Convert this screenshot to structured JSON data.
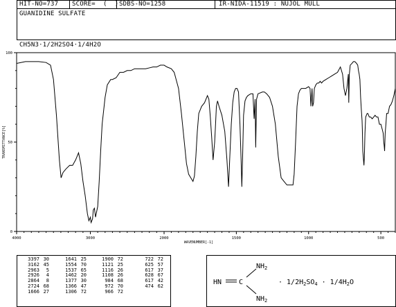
{
  "header": {
    "hit_no": "HIT-NO=737",
    "score": "SCORE=  (  )",
    "sdbs_no": "SDBS-NO=1258",
    "ir_id": "IR-NIDA-11519 : NUJOL MULL",
    "compound_name": "GUANIDINE SULFATE",
    "formula": "CH5N3·1/2H2SO4·1/4H2O"
  },
  "chart_data": {
    "type": "line",
    "xlabel": "WAVENUMBER[-1]",
    "ylabel": "TRANSMITTANCE[%]",
    "xlim": [
      4000,
      400
    ],
    "ylim": [
      0,
      100
    ],
    "x_tick_labels": [
      "4000",
      "3000",
      "2000",
      "1500",
      "1000",
      "500"
    ],
    "y_tick_labels": [
      "0",
      "50",
      "100"
    ],
    "series": [
      {
        "color": "#000000",
        "points": [
          [
            4000,
            94
          ],
          [
            3880,
            95
          ],
          [
            3800,
            95
          ],
          [
            3700,
            95
          ],
          [
            3600,
            94.5
          ],
          [
            3540,
            93
          ],
          [
            3500,
            85
          ],
          [
            3460,
            65
          ],
          [
            3420,
            40
          ],
          [
            3397,
            30
          ],
          [
            3370,
            33
          ],
          [
            3330,
            35
          ],
          [
            3280,
            37
          ],
          [
            3240,
            37
          ],
          [
            3200,
            40
          ],
          [
            3180,
            42
          ],
          [
            3160,
            44
          ],
          [
            3130,
            38
          ],
          [
            3100,
            28
          ],
          [
            3070,
            20
          ],
          [
            3040,
            10
          ],
          [
            3020,
            6
          ],
          [
            3000,
            8
          ],
          [
            2990,
            5
          ],
          [
            2970,
            7
          ],
          [
            2960,
            12
          ],
          [
            2945,
            13
          ],
          [
            2930,
            8
          ],
          [
            2900,
            14
          ],
          [
            2880,
            28
          ],
          [
            2860,
            45
          ],
          [
            2840,
            60
          ],
          [
            2800,
            75
          ],
          [
            2770,
            82
          ],
          [
            2724,
            85
          ],
          [
            2700,
            85
          ],
          [
            2650,
            86
          ],
          [
            2600,
            89
          ],
          [
            2550,
            89
          ],
          [
            2500,
            90
          ],
          [
            2450,
            90
          ],
          [
            2400,
            91
          ],
          [
            2350,
            91
          ],
          [
            2300,
            91
          ],
          [
            2250,
            91
          ],
          [
            2200,
            91.5
          ],
          [
            2150,
            92
          ],
          [
            2100,
            92
          ],
          [
            2050,
            93
          ],
          [
            2000,
            93
          ],
          [
            1980,
            92
          ],
          [
            1950,
            91
          ],
          [
            1930,
            89
          ],
          [
            1900,
            80
          ],
          [
            1880,
            66
          ],
          [
            1860,
            50
          ],
          [
            1845,
            38
          ],
          [
            1830,
            32
          ],
          [
            1815,
            30
          ],
          [
            1800,
            28
          ],
          [
            1790,
            31
          ],
          [
            1780,
            42
          ],
          [
            1770,
            56
          ],
          [
            1760,
            66
          ],
          [
            1740,
            70
          ],
          [
            1720,
            72
          ],
          [
            1700,
            76
          ],
          [
            1690,
            74
          ],
          [
            1680,
            64
          ],
          [
            1670,
            52
          ],
          [
            1661,
            40
          ],
          [
            1650,
            50
          ],
          [
            1645,
            58
          ],
          [
            1638,
            70
          ],
          [
            1630,
            73
          ],
          [
            1620,
            70
          ],
          [
            1600,
            65
          ],
          [
            1580,
            56
          ],
          [
            1565,
            40
          ],
          [
            1554,
            25
          ],
          [
            1545,
            42
          ],
          [
            1535,
            60
          ],
          [
            1525,
            72
          ],
          [
            1515,
            78
          ],
          [
            1505,
            80
          ],
          [
            1495,
            80
          ],
          [
            1485,
            78
          ],
          [
            1475,
            60
          ],
          [
            1467,
            40
          ],
          [
            1462,
            25
          ],
          [
            1457,
            40
          ],
          [
            1450,
            65
          ],
          [
            1440,
            73
          ],
          [
            1430,
            75
          ],
          [
            1420,
            76
          ],
          [
            1400,
            77
          ],
          [
            1385,
            77
          ],
          [
            1377,
            63
          ],
          [
            1370,
            74
          ],
          [
            1366,
            47
          ],
          [
            1360,
            74
          ],
          [
            1350,
            77
          ],
          [
            1320,
            78
          ],
          [
            1306,
            78
          ],
          [
            1290,
            77
          ],
          [
            1270,
            75
          ],
          [
            1250,
            70
          ],
          [
            1230,
            60
          ],
          [
            1210,
            42
          ],
          [
            1190,
            30
          ],
          [
            1170,
            28
          ],
          [
            1150,
            26
          ],
          [
            1130,
            26
          ],
          [
            1121,
            26
          ],
          [
            1116,
            26
          ],
          [
            1108,
            26
          ],
          [
            1100,
            32
          ],
          [
            1090,
            50
          ],
          [
            1080,
            70
          ],
          [
            1070,
            77
          ],
          [
            1060,
            79
          ],
          [
            1050,
            80
          ],
          [
            1040,
            80
          ],
          [
            1030,
            80
          ],
          [
            1020,
            80
          ],
          [
            1000,
            81
          ],
          [
            990,
            80
          ],
          [
            984,
            70
          ],
          [
            976,
            80
          ],
          [
            972,
            70
          ],
          [
            966,
            72
          ],
          [
            960,
            80
          ],
          [
            950,
            82
          ],
          [
            940,
            83
          ],
          [
            930,
            83
          ],
          [
            920,
            84
          ],
          [
            910,
            83
          ],
          [
            900,
            84
          ],
          [
            880,
            85
          ],
          [
            860,
            86
          ],
          [
            840,
            87
          ],
          [
            820,
            88
          ],
          [
            800,
            89
          ],
          [
            780,
            92
          ],
          [
            765,
            88
          ],
          [
            755,
            80
          ],
          [
            745,
            76
          ],
          [
            735,
            80
          ],
          [
            725,
            88
          ],
          [
            722,
            72
          ],
          [
            718,
            88
          ],
          [
            712,
            93
          ],
          [
            700,
            94
          ],
          [
            690,
            95
          ],
          [
            680,
            95
          ],
          [
            668,
            94
          ],
          [
            660,
            93
          ],
          [
            655,
            90
          ],
          [
            650,
            88
          ],
          [
            645,
            85
          ],
          [
            640,
            75
          ],
          [
            635,
            68
          ],
          [
            630,
            62
          ],
          [
            628,
            57
          ],
          [
            625,
            45
          ],
          [
            620,
            40
          ],
          [
            617,
            37
          ],
          [
            614,
            42
          ],
          [
            610,
            55
          ],
          [
            605,
            64
          ],
          [
            600,
            65
          ],
          [
            595,
            66
          ],
          [
            590,
            66
          ],
          [
            585,
            65
          ],
          [
            580,
            64
          ],
          [
            570,
            64
          ],
          [
            560,
            63
          ],
          [
            550,
            64
          ],
          [
            540,
            65
          ],
          [
            530,
            64
          ],
          [
            520,
            64
          ],
          [
            510,
            60
          ],
          [
            500,
            60
          ],
          [
            490,
            57
          ],
          [
            484,
            55
          ],
          [
            480,
            50
          ],
          [
            477,
            48
          ],
          [
            474,
            45
          ],
          [
            470,
            55
          ],
          [
            465,
            60
          ],
          [
            460,
            66
          ],
          [
            455,
            66
          ],
          [
            450,
            66
          ],
          [
            445,
            68
          ],
          [
            440,
            70
          ],
          [
            430,
            71
          ],
          [
            420,
            73
          ],
          [
            410,
            76
          ],
          [
            400,
            80
          ]
        ]
      }
    ]
  },
  "peak_table": {
    "columns": [
      {
        "wn": [
          "3397",
          "3162",
          "2963",
          "2926",
          "2864",
          "2724",
          "1666"
        ],
        "t": [
          "30",
          "45",
          "5",
          "4",
          "8",
          "68",
          "27"
        ]
      },
      {
        "wn": [
          "1641",
          "1554",
          "1537",
          "1462",
          "1377",
          "1366",
          "1306"
        ],
        "t": [
          "25",
          "70",
          "65",
          "20",
          "30",
          "47",
          "72"
        ]
      },
      {
        "wn": [
          "1900",
          "1121",
          "1116",
          "1108",
          "984",
          "972",
          "966"
        ],
        "t": [
          "72",
          "25",
          "26",
          "26",
          "68",
          "70",
          "72"
        ]
      },
      {
        "wn": [
          "722",
          "625",
          "617",
          "628",
          "617",
          "474",
          ""
        ],
        "t": [
          "72",
          "57",
          "37",
          "67",
          "42",
          "62",
          ""
        ]
      }
    ]
  },
  "structure": {
    "imine": "HN=",
    "carbon": "C",
    "amine_top": "NH2",
    "amine_bottom": "NH2",
    "salt": "· 1/2H2SO4 · 1/4H2O"
  }
}
